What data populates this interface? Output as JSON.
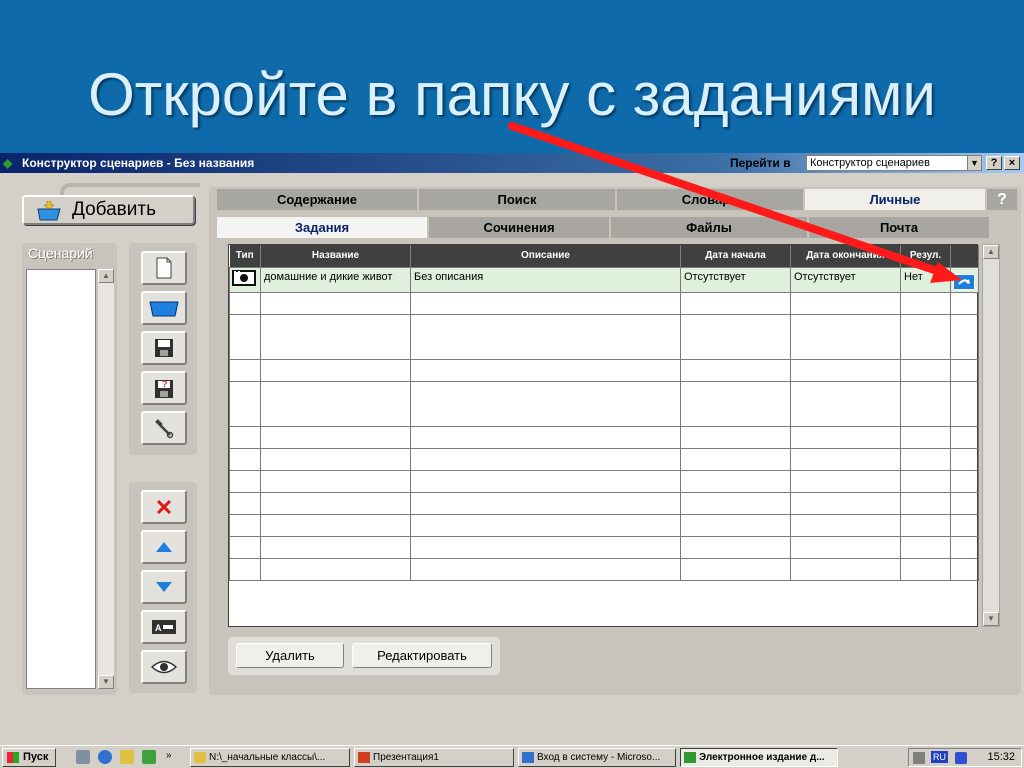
{
  "slide": {
    "title": "Откройте в папку с заданиями"
  },
  "window": {
    "title": "Конструктор сценариев - Без названия",
    "goto_label": "Перейти в",
    "goto_value": "Конструктор сценариев",
    "help_btn": "?",
    "close_btn": "×"
  },
  "sidebar": {
    "add_label": "Добавить",
    "scenario_label": "Сценарий"
  },
  "tabs_top": [
    "Содержание",
    "Поиск",
    "Словарь",
    "Личные"
  ],
  "tabs_sub": [
    "Задания",
    "Сочинения",
    "Файлы",
    "Почта"
  ],
  "help_tab": "?",
  "table": {
    "columns": [
      "Тип",
      "Название",
      "Описание",
      "Дата начала",
      "Дата окончания",
      "Резул.",
      ""
    ],
    "rows": [
      {
        "name": "домашние и дикие живот",
        "description": "Без описания",
        "start": "Отсутствует",
        "end": "Отсутствует",
        "result": "Нет"
      }
    ]
  },
  "actions": {
    "delete": "Удалить",
    "edit": "Редактировать"
  },
  "taskbar": {
    "start": "Пуск",
    "tasks": [
      "N:\\_начальные классы\\...",
      "Презентация1",
      "Вход в систему - Microso...",
      "Электронное издание д..."
    ],
    "lang": "RU",
    "clock": "15:32"
  },
  "colors": {
    "arrow": "#ff1a1a",
    "title_bar": "#0a246a",
    "slide_bg": "#0e6aaa"
  }
}
